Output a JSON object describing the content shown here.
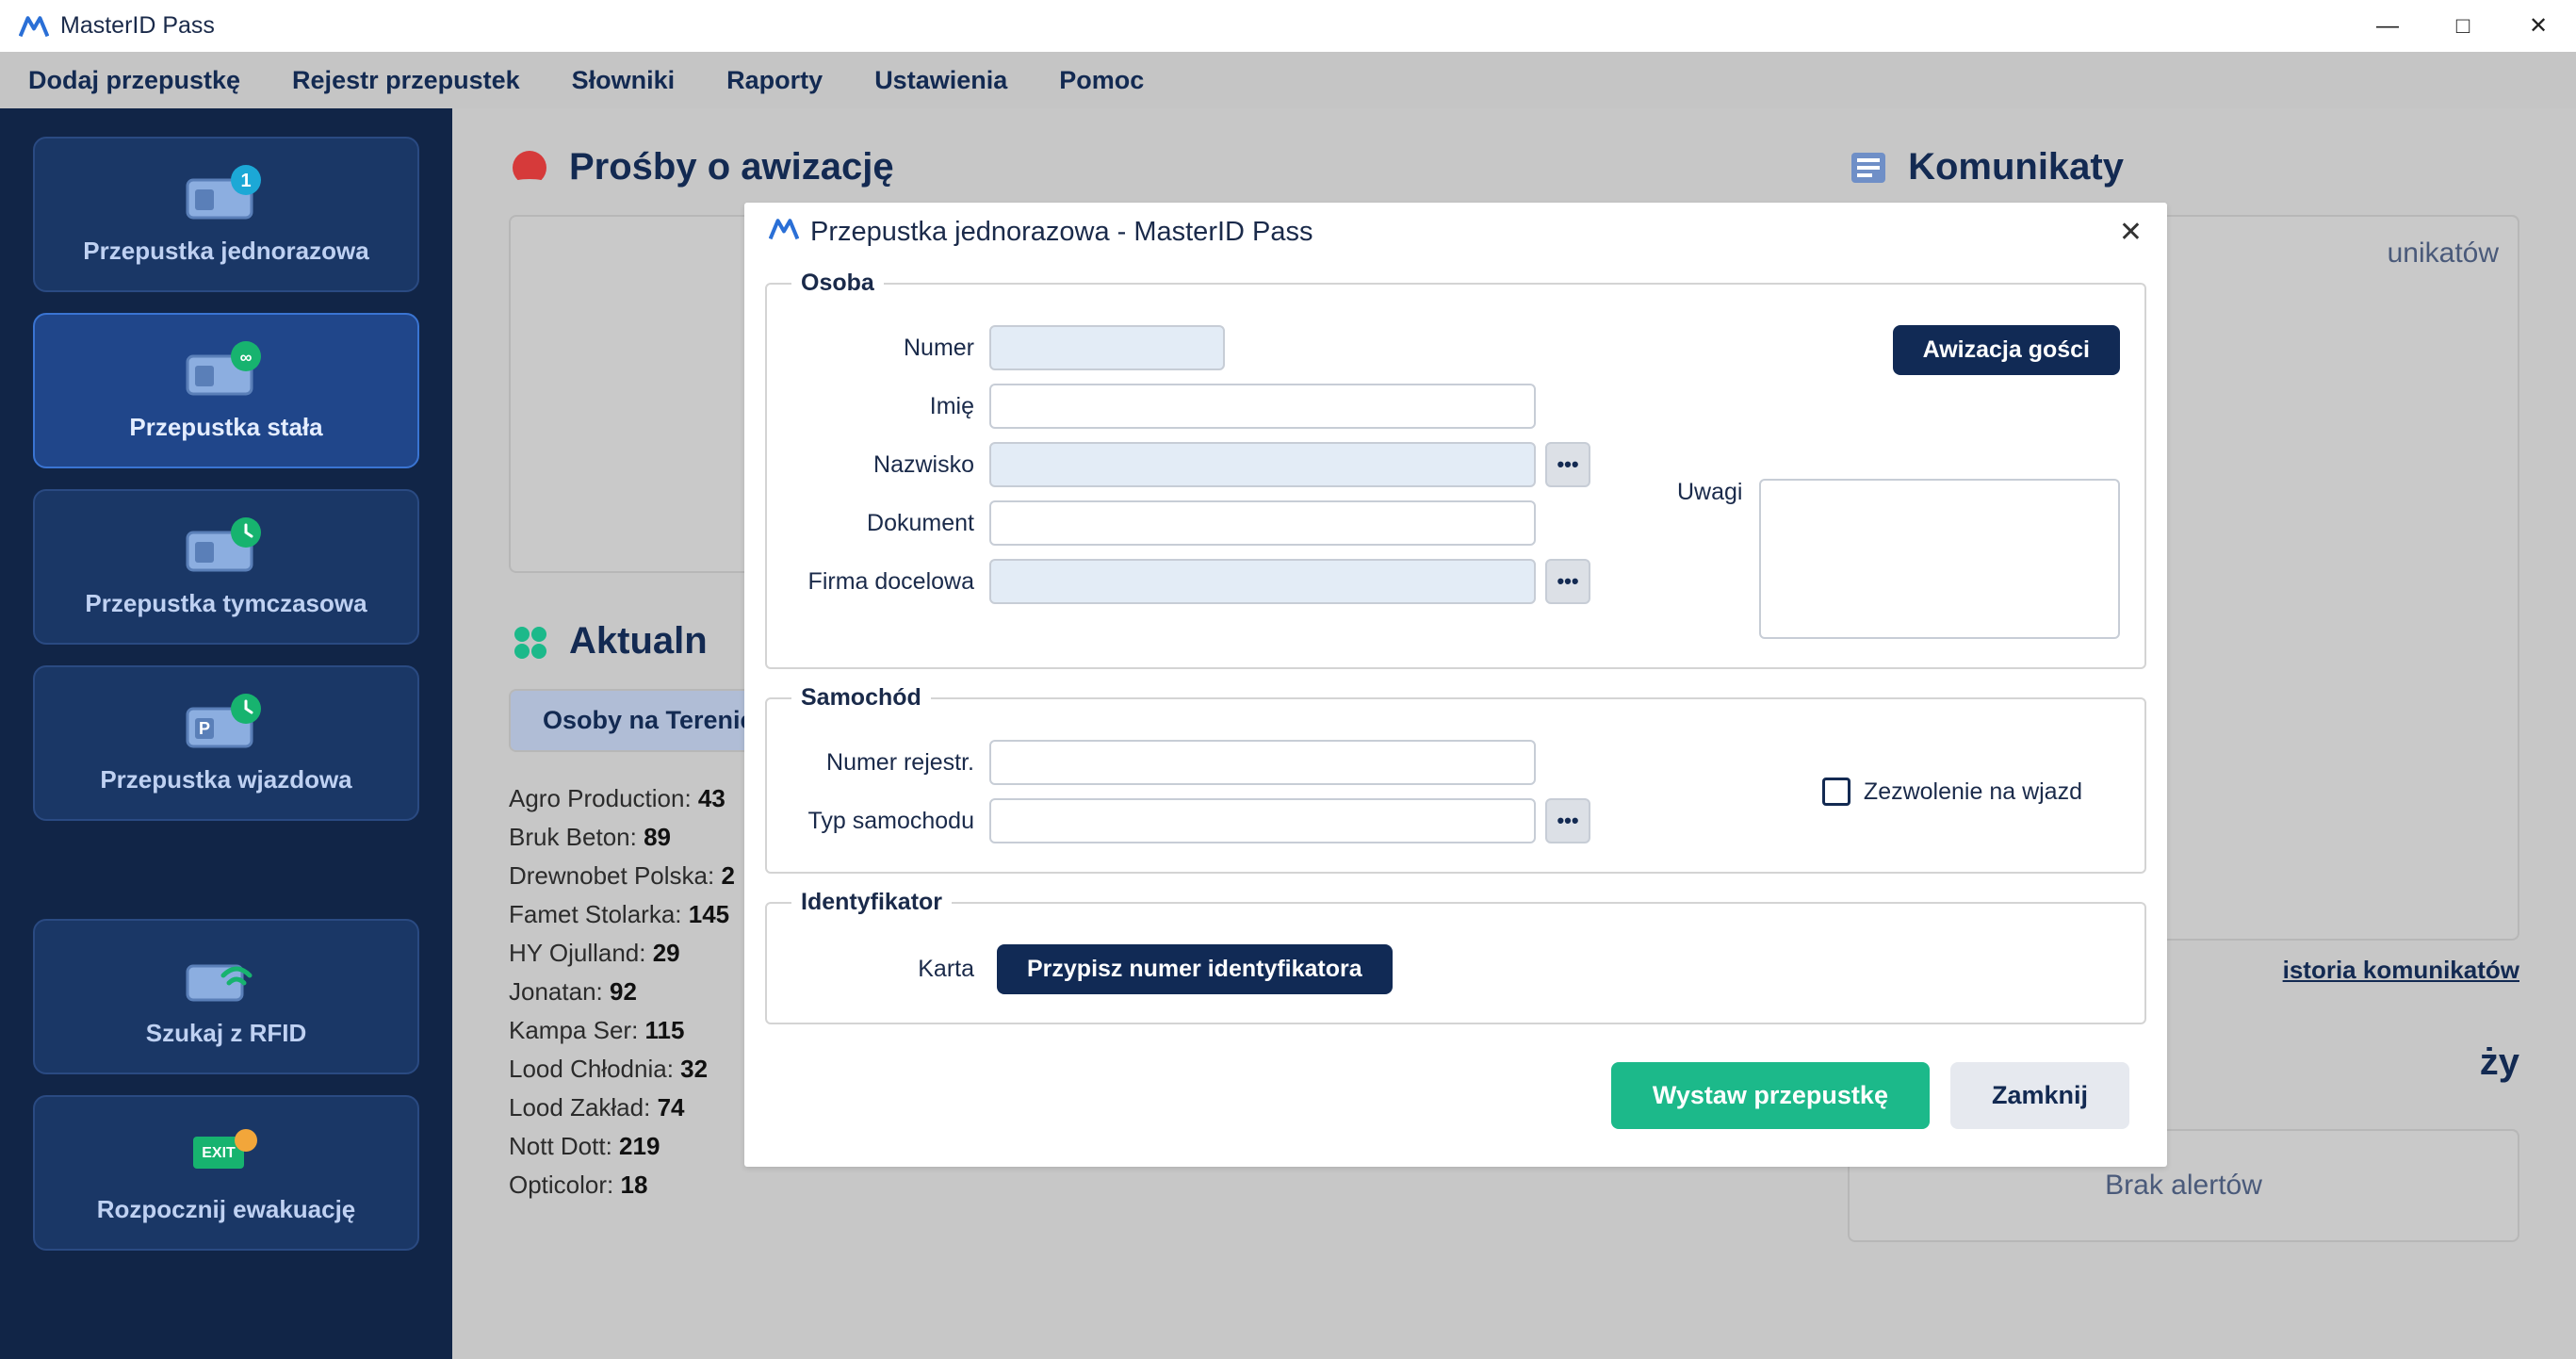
{
  "window": {
    "title": "MasterID Pass",
    "win_controls": {
      "min": "—",
      "max": "□",
      "close": "✕"
    }
  },
  "menubar": [
    "Dodaj przepustkę",
    "Rejestr przepustek",
    "Słowniki",
    "Raporty",
    "Ustawienia",
    "Pomoc"
  ],
  "sidebar": {
    "items": [
      {
        "label": "Przepustka jednorazowa",
        "icon": "one"
      },
      {
        "label": "Przepustka stała",
        "icon": "inf",
        "selected": true
      },
      {
        "label": "Przepustka tymczasowa",
        "icon": "clock"
      },
      {
        "label": "Przepustka wjazdowa",
        "icon": "park"
      }
    ],
    "rfid": {
      "label": "Szukaj z RFID"
    },
    "evac": {
      "label": "Rozpocznij ewakuację"
    }
  },
  "main": {
    "requests_title": "Prośby o awizację",
    "messages_title": "Komunikaty",
    "messages_empty": "unikatów",
    "history_link": "istoria komunikatów",
    "alerts_title_partial": "ży",
    "alerts_empty": "Brak alertów",
    "status_title": "Aktualn",
    "tab_active": "Osoby na Terenie",
    "status_list": [
      {
        "name": "Agro Production",
        "val": "43"
      },
      {
        "name": "Bruk Beton",
        "val": "89"
      },
      {
        "name": "Drewnobet Polska",
        "val": "2"
      },
      {
        "name": "Famet Stolarka",
        "val": "145"
      },
      {
        "name": "HY Ojulland",
        "val": "29"
      },
      {
        "name": "Jonatan",
        "val": "92"
      },
      {
        "name": "Kampa Ser",
        "val": "115"
      },
      {
        "name": "Lood Chłodnia",
        "val": "32"
      },
      {
        "name": "Lood Zakład",
        "val": "74"
      },
      {
        "name": "Nott Dott",
        "val": "219"
      },
      {
        "name": "Opticolor",
        "val": "18"
      }
    ]
  },
  "dialog": {
    "title": "Przepustka jednorazowa - MasterID Pass",
    "osoba": {
      "legend": "Osoba",
      "numer": "Numer",
      "imie": "Imię",
      "nazwisko": "Nazwisko",
      "dokument": "Dokument",
      "firma": "Firma docelowa",
      "awizacja_btn": "Awizacja gości",
      "uwagi": "Uwagi"
    },
    "samo": {
      "legend": "Samochód",
      "rejestr": "Numer rejestr.",
      "typ": "Typ samochodu",
      "zezw": "Zezwolenie na wjazd"
    },
    "ident": {
      "legend": "Identyfikator",
      "karta": "Karta",
      "btn": "Przypisz numer identyfikatora"
    },
    "footer": {
      "issue": "Wystaw przepustkę",
      "close": "Zamknij"
    }
  }
}
